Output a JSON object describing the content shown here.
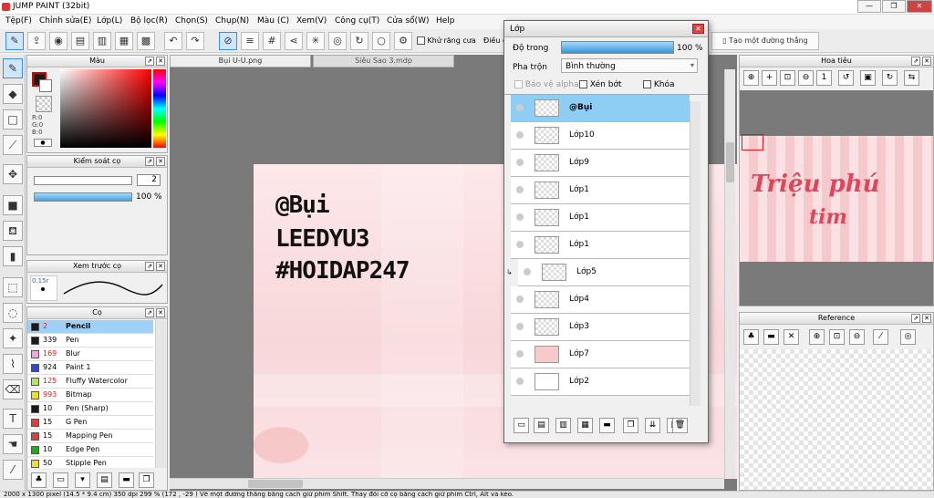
{
  "window": {
    "title": "JUMP PAINT (32bit)"
  },
  "menu": [
    "Tệp(F)",
    "Chỉnh sửa(E)",
    "Lớp(L)",
    "Bộ lọc(R)",
    "Chọn(S)",
    "Chụp(N)",
    "Màu (C)",
    "Xem(V)",
    "Công cụ(T)",
    "Cửa sổ(W)",
    "Help"
  ],
  "toolbar": {
    "antialias": "Khử răng cưa",
    "adjust": "Điều c",
    "straight_line": "Tạo một đường thẳng"
  },
  "color_panel": {
    "title": "Màu",
    "r": "R:0",
    "g": "G:0",
    "b": "B:0",
    "fg": "#1a1a1a"
  },
  "brush_control": {
    "title": "Kiểm soát cọ",
    "size": "2",
    "opacity": "100 %"
  },
  "brush_preview": {
    "title": "Xem trước cọ",
    "size": "0.15r"
  },
  "brushes": {
    "title": "Cọ",
    "items": [
      {
        "num": "2",
        "name": "Pencil",
        "color": "#1a1a1a"
      },
      {
        "num": "339",
        "name": "Pen",
        "color": "#1a1a1a"
      },
      {
        "num": "169",
        "name": "Blur",
        "color": "#f4a6e0"
      },
      {
        "num": "924",
        "name": "Paint 1",
        "color": "#3344dd"
      },
      {
        "num": "125",
        "name": "Fluffy Watercolor",
        "color": "#b5e65a"
      },
      {
        "num": "993",
        "name": "Bitmap",
        "color": "#f0e020"
      },
      {
        "num": "10",
        "name": "Pen (Sharp)",
        "color": "#1a1a1a"
      },
      {
        "num": "15",
        "name": "G Pen",
        "color": "#e63a3a"
      },
      {
        "num": "15",
        "name": "Mapping Pen",
        "color": "#e63a3a"
      },
      {
        "num": "10",
        "name": "Edge Pen",
        "color": "#22aa22"
      },
      {
        "num": "50",
        "name": "Stipple Pen",
        "color": "#f0e020"
      }
    ]
  },
  "documents": {
    "tabs": [
      "Bụi U-U.png",
      "Siêu Sao 3.mdp"
    ]
  },
  "canvas": {
    "line1": "@Bụi",
    "line2": "LEEDYU3",
    "line3": "#HOIDAP247"
  },
  "layer_window": {
    "title": "Lớp",
    "opacity_label": "Độ trong",
    "opacity_value": "100 %",
    "opacity_level": 1.0,
    "blend_label": "Pha trộn",
    "blend_value": "Bình thường",
    "protect_alpha": "Bảo vệ alpha",
    "clipping": "Xén bớt",
    "lock": "Khóa",
    "layers": [
      "@Bụi",
      "Lớp10",
      "Lớp9",
      "Lớp1",
      "Lớp1",
      "Lớp1",
      "Lớp5",
      "Lớp4",
      "Lớp3",
      "Lớp7",
      "Lớp2"
    ]
  },
  "navigator": {
    "title": "Hoa tiêu",
    "art_text_1": "Triệu phú",
    "art_text_2": "tim"
  },
  "reference": {
    "title": "Reference"
  },
  "status": {
    "text": "2000 x 1300 pixel   (14.5 * 9.4 cm)   350 dpi   299 %   (172 , -29 )   Vẽ một đường thẳng bằng cách giữ phím Shift. Thay đổi cỡ cọ bằng cách giữ phím Ctrl, Alt và kéo."
  }
}
